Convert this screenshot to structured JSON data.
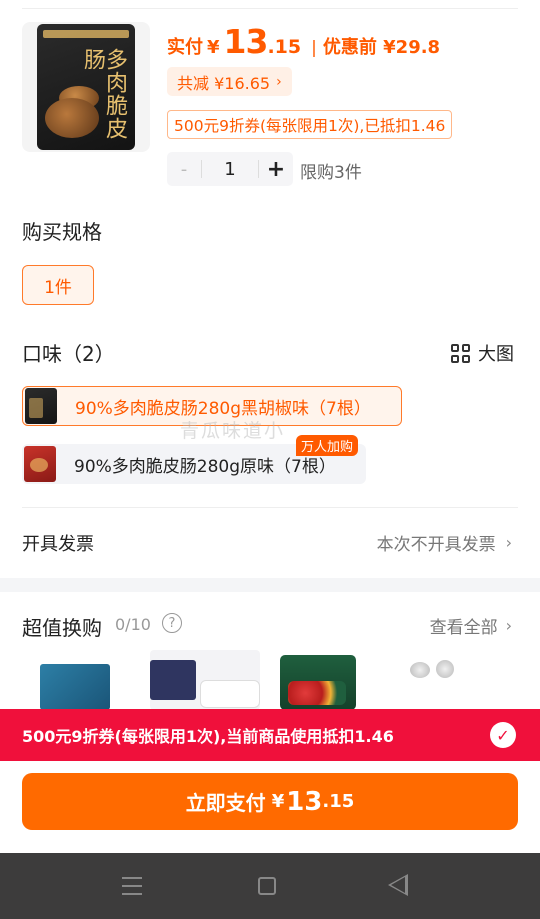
{
  "product": {
    "image_icon": "sausage-package-icon",
    "package_title": "多肉脆皮肠",
    "pay_label": "实付",
    "currency": "¥",
    "pay_int": "13",
    "pay_dec": ".15",
    "separator": "|",
    "before_discount": "优惠前 ¥29.8",
    "saved_text": "共减 ¥16.65",
    "chevron": "›",
    "coupon_text": "500元9折券(每张限用1次),已抵扣1.46",
    "quantity": {
      "minus": "-",
      "value": "1",
      "plus": "+"
    },
    "limit_text": "限购3件"
  },
  "spec": {
    "title": "购买规格",
    "options": [
      {
        "label": "1件",
        "selected": true
      }
    ]
  },
  "flavor": {
    "title": "口味（2）",
    "big_view_label": "大图",
    "options": [
      {
        "label": "90%多肉脆皮肠280g黑胡椒味（7根）",
        "selected": true
      },
      {
        "label": "90%多肉脆皮肠280g原味（7根）",
        "selected": false,
        "badge": "万人加购"
      }
    ],
    "watermark": "青瓜味道小"
  },
  "invoice": {
    "label": "开具发票",
    "value": "本次不开具发票",
    "chevron": "›"
  },
  "deals": {
    "title": "超值换购",
    "count": "0/10",
    "help": "?",
    "see_all": "查看全部",
    "chevron": "›"
  },
  "banner": {
    "text": "500元9折券(每张限用1次),当前商品使用抵扣1.46",
    "check": "✓"
  },
  "pay_button": {
    "label": "立即支付",
    "currency": "¥",
    "int": "13",
    "dec": ".15"
  },
  "colors": {
    "accent": "#ff5a00",
    "button": "#ff6a00",
    "banner": "#f0103b",
    "navbar": "#3d3c3c"
  }
}
